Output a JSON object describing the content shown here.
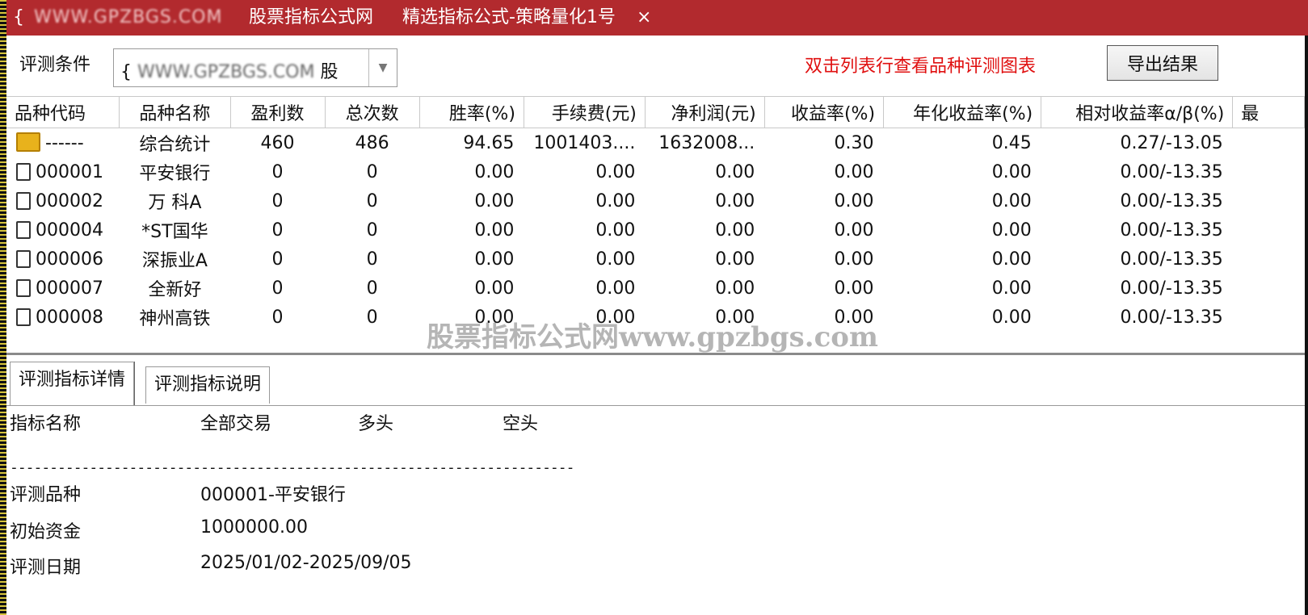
{
  "titlebar": {
    "brace": "{",
    "site": "WWW.GPZBGS.COM",
    "app_name": "股票指标公式网",
    "formula_name": "精选指标公式-策略量化1号",
    "close_glyph": "×"
  },
  "toolbar": {
    "condition_label": "评测条件",
    "condition_value_prefix": "{",
    "condition_value_site": "WWW.GPZBGS.COM",
    "condition_value_tail": "股",
    "hint_text": "双击列表行查看品种评测图表",
    "export_label": "导出结果"
  },
  "grid": {
    "columns": [
      "品种代码",
      "品种名称",
      "盈利数",
      "总次数",
      "胜率(%)",
      "手续费(元)",
      "净利润(元)",
      "收益率(%)",
      "年化收益率(%)",
      "相对收益率α/β(%)",
      "最"
    ],
    "rows": [
      {
        "code": "------",
        "name": "综合统计",
        "win": "460",
        "total": "486",
        "rate": "94.65",
        "fee": "1001403....",
        "profit": "1632008...",
        "ret": "0.30",
        "annual": "0.45",
        "rel": "0.27/-13.05",
        "summary": true
      },
      {
        "code": "000001",
        "name": "平安银行",
        "win": "0",
        "total": "0",
        "rate": "0.00",
        "fee": "0.00",
        "profit": "0.00",
        "ret": "0.00",
        "annual": "0.00",
        "rel": "0.00/-13.35"
      },
      {
        "code": "000002",
        "name": "万 科A",
        "win": "0",
        "total": "0",
        "rate": "0.00",
        "fee": "0.00",
        "profit": "0.00",
        "ret": "0.00",
        "annual": "0.00",
        "rel": "0.00/-13.35"
      },
      {
        "code": "000004",
        "name": "*ST国华",
        "win": "0",
        "total": "0",
        "rate": "0.00",
        "fee": "0.00",
        "profit": "0.00",
        "ret": "0.00",
        "annual": "0.00",
        "rel": "0.00/-13.35"
      },
      {
        "code": "000006",
        "name": "深振业A",
        "win": "0",
        "total": "0",
        "rate": "0.00",
        "fee": "0.00",
        "profit": "0.00",
        "ret": "0.00",
        "annual": "0.00",
        "rel": "0.00/-13.35"
      },
      {
        "code": "000007",
        "name": "全新好",
        "win": "0",
        "total": "0",
        "rate": "0.00",
        "fee": "0.00",
        "profit": "0.00",
        "ret": "0.00",
        "annual": "0.00",
        "rel": "0.00/-13.35"
      },
      {
        "code": "000008",
        "name": "神州高铁",
        "win": "0",
        "total": "0",
        "rate": "0.00",
        "fee": "0.00",
        "profit": "0.00",
        "ret": "0.00",
        "annual": "0.00",
        "rel": "0.00/-13.35"
      }
    ]
  },
  "watermark": "股票指标公式网www.gpzbgs.com",
  "tabs": [
    "评测指标详情",
    "评测指标说明"
  ],
  "detail": {
    "headers": [
      "指标名称",
      "全部交易",
      "多头",
      "空头"
    ],
    "separator": "-----------------------------------------------------------------------",
    "rows": [
      {
        "label": "评测品种",
        "value": "000001-平安银行"
      },
      {
        "label": "初始资金",
        "value": "1000000.00"
      },
      {
        "label": "评测日期",
        "value": "2025/01/02-2025/09/05"
      }
    ]
  },
  "colors": {
    "titlebar": "#b22a2e",
    "hint": "#e01010",
    "summary_icon": "#e8b21c"
  }
}
